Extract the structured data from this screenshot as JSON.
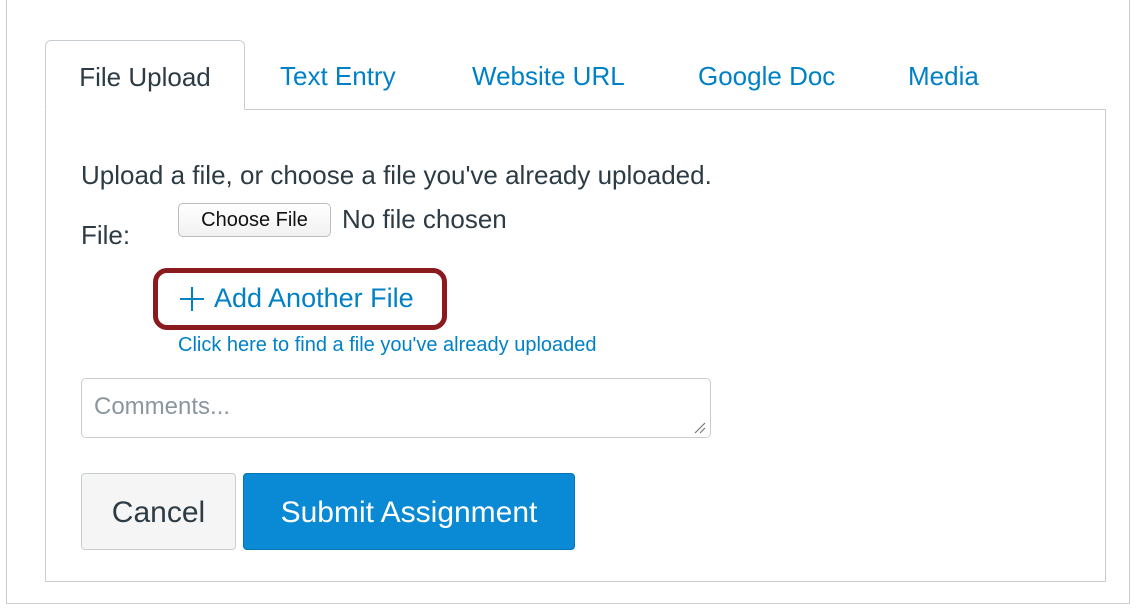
{
  "tabs": [
    {
      "label": "File Upload",
      "active": true
    },
    {
      "label": "Text Entry",
      "active": false
    },
    {
      "label": "Website URL",
      "active": false
    },
    {
      "label": "Google Doc",
      "active": false
    },
    {
      "label": "Media",
      "active": false
    }
  ],
  "upload": {
    "instructions": "Upload a file, or choose a file you've already uploaded.",
    "file_label": "File:",
    "choose_button": "Choose File",
    "no_file_text": "No file chosen",
    "add_another_label": "Add Another File",
    "find_uploaded_link": "Click here to find a file you've already uploaded"
  },
  "comments": {
    "placeholder": "Comments...",
    "value": ""
  },
  "actions": {
    "cancel_label": "Cancel",
    "submit_label": "Submit Assignment"
  },
  "colors": {
    "link": "#0081c6",
    "primary_button": "#0a89d4",
    "highlight_border": "#8b1a1f",
    "text": "#2d3b45"
  }
}
